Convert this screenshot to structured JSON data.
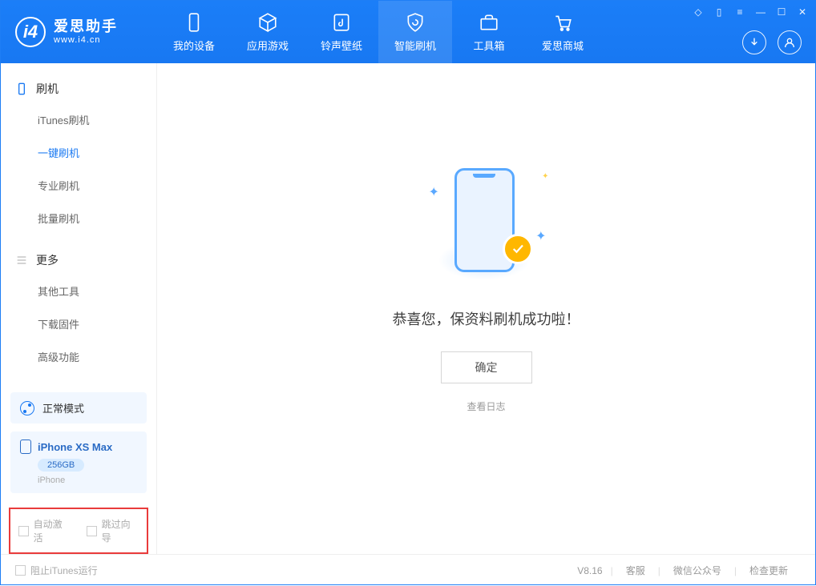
{
  "app": {
    "name_cn": "爱思助手",
    "name_en": "www.i4.cn"
  },
  "tabs": [
    {
      "label": "我的设备"
    },
    {
      "label": "应用游戏"
    },
    {
      "label": "铃声壁纸"
    },
    {
      "label": "智能刷机"
    },
    {
      "label": "工具箱"
    },
    {
      "label": "爱思商城"
    }
  ],
  "sidebar": {
    "section1": {
      "title": "刷机",
      "items": [
        "iTunes刷机",
        "一键刷机",
        "专业刷机",
        "批量刷机"
      ]
    },
    "section2": {
      "title": "更多",
      "items": [
        "其他工具",
        "下载固件",
        "高级功能"
      ]
    }
  },
  "mode": {
    "label": "正常模式"
  },
  "device": {
    "name": "iPhone XS Max",
    "capacity": "256GB",
    "subtitle": "iPhone"
  },
  "options": {
    "auto_activate": "自动激活",
    "skip_guide": "跳过向导"
  },
  "main": {
    "success_msg": "恭喜您，保资料刷机成功啦！",
    "ok": "确定",
    "view_log": "查看日志"
  },
  "footer": {
    "block_itunes": "阻止iTunes运行",
    "version": "V8.16",
    "links": [
      "客服",
      "微信公众号",
      "检查更新"
    ]
  }
}
